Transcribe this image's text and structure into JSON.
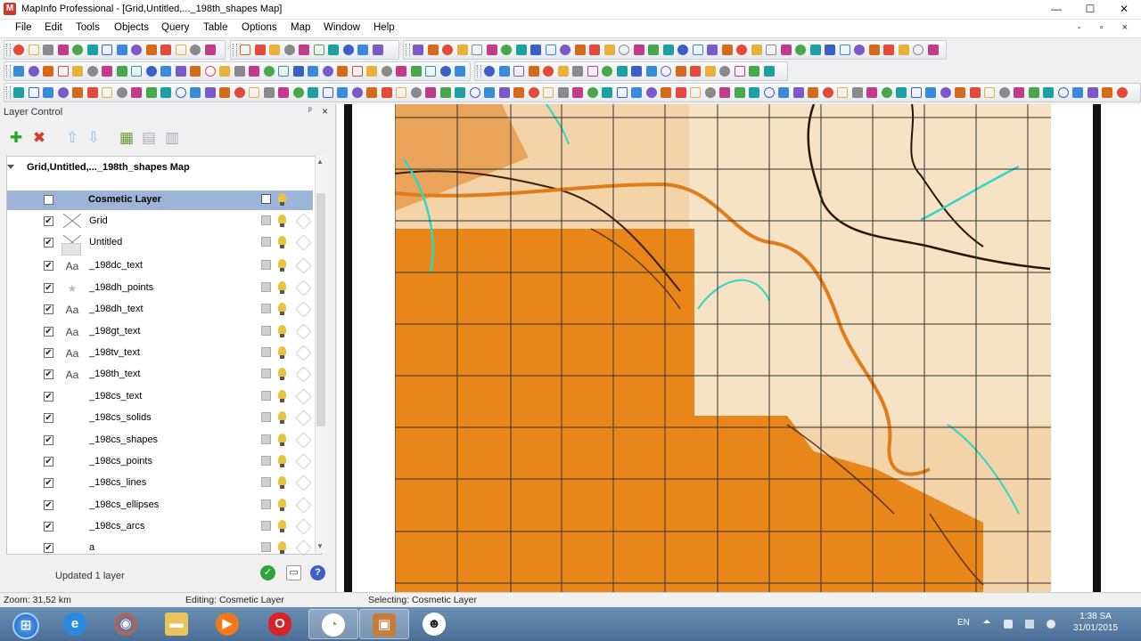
{
  "window": {
    "title": "MapInfo Professional - [Grid,Untitled,..._198th_shapes Map]",
    "minimize": "—",
    "maximize": "☐",
    "close": "✕"
  },
  "menubar": {
    "items": [
      "File",
      "Edit",
      "Tools",
      "Objects",
      "Query",
      "Table",
      "Options",
      "Map",
      "Window",
      "Help"
    ],
    "mdi_controls": "- ▫ ×"
  },
  "layer_control": {
    "title": "Layer Control",
    "pin": "ᵖ",
    "close": "×",
    "root": "Grid,Untitled,..._198th_shapes Map",
    "layers": [
      {
        "name": "Cosmetic Layer",
        "checked": false,
        "type_icon": "",
        "selected": true
      },
      {
        "name": "Grid",
        "checked": true,
        "type_icon": "grid"
      },
      {
        "name": "Untitled",
        "checked": true,
        "type_icon": "grid"
      },
      {
        "name": "_198dc_text",
        "checked": true,
        "type_icon": "Aa"
      },
      {
        "name": "_198dh_points",
        "checked": true,
        "type_icon": "★"
      },
      {
        "name": "_198dh_text",
        "checked": true,
        "type_icon": "Aa"
      },
      {
        "name": "_198gt_text",
        "checked": true,
        "type_icon": "Aa"
      },
      {
        "name": "_198tv_text",
        "checked": true,
        "type_icon": "Aa"
      },
      {
        "name": "_198th_text",
        "checked": true,
        "type_icon": "Aa"
      },
      {
        "name": "_198cs_text",
        "checked": true,
        "type_icon": ""
      },
      {
        "name": "_198cs_solids",
        "checked": true,
        "type_icon": ""
      },
      {
        "name": "_198cs_shapes",
        "checked": true,
        "type_icon": ""
      },
      {
        "name": "_198cs_points",
        "checked": true,
        "type_icon": ""
      },
      {
        "name": "_198cs_lines",
        "checked": true,
        "type_icon": ""
      },
      {
        "name": "_198cs_ellipses",
        "checked": true,
        "type_icon": ""
      },
      {
        "name": "_198cs_arcs",
        "checked": true,
        "type_icon": ""
      },
      {
        "name": "a",
        "checked": true,
        "type_icon": ""
      }
    ],
    "status_message": "Updated 1 layer",
    "add_glyph": "✚",
    "remove_glyph": "✖",
    "ok_glyph": "✓",
    "help_glyph": "?"
  },
  "statusbar": {
    "zoom": "Zoom: 31,52 km",
    "editing": "Editing: Cosmetic Layer",
    "selecting": "Selecting: Cosmetic Layer"
  },
  "taskbar": {
    "apps": [
      "start",
      "internet-explorer",
      "firefox",
      "file-explorer",
      "media-player",
      "opera",
      "app-launcher",
      "mapinfo",
      "panda"
    ],
    "language": "EN",
    "time": "1:38 SA",
    "date": "31/01/2015"
  },
  "colors": {
    "map_orange": "#e8861a",
    "map_light": "#f3d3a8",
    "river_cyan": "#2fd6c8",
    "selection": "#9db4d8"
  }
}
